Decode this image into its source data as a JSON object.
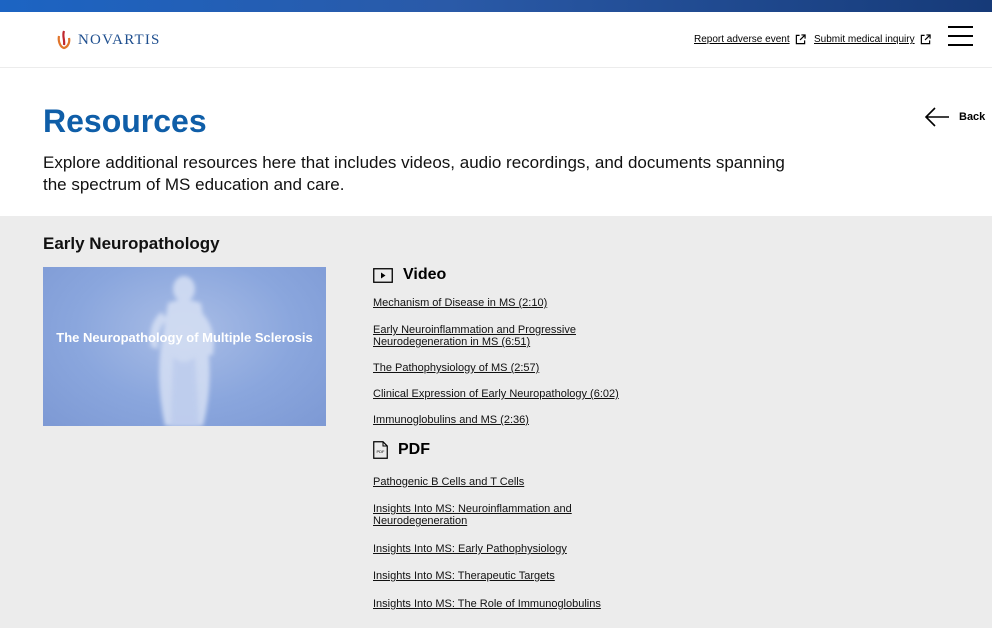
{
  "header": {
    "logo_text": "NOVARTIS",
    "links": [
      {
        "label": "Report adverse event"
      },
      {
        "label": "Submit medical inquiry"
      }
    ]
  },
  "hero": {
    "title": "Resources",
    "description": "Explore additional resources here that includes videos, audio recordings, and documents spanning the spectrum of MS education and care.",
    "back_label": "Back"
  },
  "section": {
    "title": "Early Neuropathology",
    "thumbnail_text": "The Neuropathology of Multiple Sclerosis",
    "video": {
      "heading": "Video",
      "icon": "play-icon",
      "items": [
        "Mechanism of Disease in MS (2:10)",
        "Early Neuroinflammation and Progressive Neurodegeneration in MS (6:51)",
        "The Pathophysiology of MS (2:57)",
        "Clinical Expression of Early Neuropathology (6:02)",
        "Immunoglobulins and MS (2:36)"
      ]
    },
    "pdf": {
      "heading": "PDF",
      "icon": "pdf-icon",
      "items": [
        "Pathogenic B Cells and T Cells",
        "Insights Into MS: Neuroinflammation and Neurodegeneration",
        "Insights Into MS: Early Pathophysiology",
        "Insights Into MS: Therapeutic Targets",
        "Insights Into MS: The Role of Immunoglobulins"
      ]
    }
  },
  "colors": {
    "brand_blue": "#0f5ea8",
    "section_bg": "#ececec"
  }
}
